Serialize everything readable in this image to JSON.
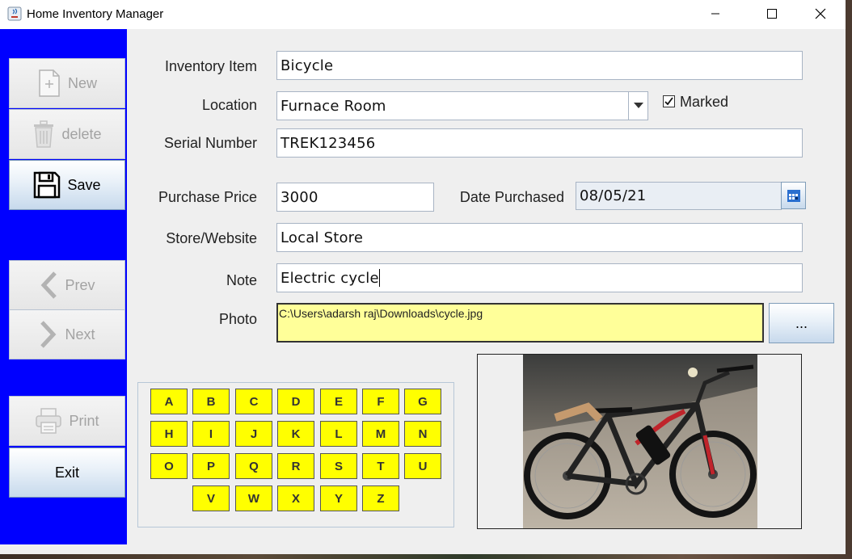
{
  "window": {
    "title": "Home Inventory Manager",
    "controls": [
      "minimize",
      "maximize",
      "close"
    ]
  },
  "sidebar": {
    "color": "#0000ff",
    "buttons": {
      "new": {
        "label": "New",
        "icon": "new-file-icon",
        "enabled": false
      },
      "delete": {
        "label": "delete",
        "icon": "trash-icon",
        "enabled": false
      },
      "save": {
        "label": "Save",
        "icon": "floppy-disk-icon",
        "enabled": true
      },
      "prev": {
        "label": "Prev",
        "icon": "chevron-left-icon",
        "enabled": false
      },
      "next": {
        "label": "Next",
        "icon": "chevron-right-icon",
        "enabled": false
      },
      "print": {
        "label": "Print",
        "icon": "printer-icon",
        "enabled": false
      },
      "exit": {
        "label": "Exit",
        "enabled": true
      }
    }
  },
  "form": {
    "item": {
      "label": "Inventory Item",
      "value": "Bicycle"
    },
    "location": {
      "label": "Location",
      "value": "Furnace Room"
    },
    "marked": {
      "label": "Marked",
      "checked": true
    },
    "serial": {
      "label": "Serial Number",
      "value": "TREK123456"
    },
    "price": {
      "label": "Purchase Price",
      "value": "3000"
    },
    "date": {
      "label": "Date Purchased",
      "value": "08/05/21"
    },
    "store": {
      "label": "Store/Website",
      "value": "Local Store"
    },
    "note": {
      "label": "Note",
      "value": "Electric cycle"
    },
    "photo": {
      "label": "Photo",
      "path": "C:\\Users\\adarsh raj\\Downloads\\cycle.jpg",
      "browse_label": "..."
    }
  },
  "keypad": {
    "color": "#ffff00",
    "rows": [
      [
        "A",
        "B",
        "C",
        "D",
        "E",
        "F",
        "G"
      ],
      [
        "H",
        "I",
        "J",
        "K",
        "L",
        "M",
        "N"
      ],
      [
        "O",
        "P",
        "Q",
        "R",
        "S",
        "T",
        "U"
      ],
      [
        "V",
        "W",
        "X",
        "Y",
        "Z"
      ]
    ]
  }
}
